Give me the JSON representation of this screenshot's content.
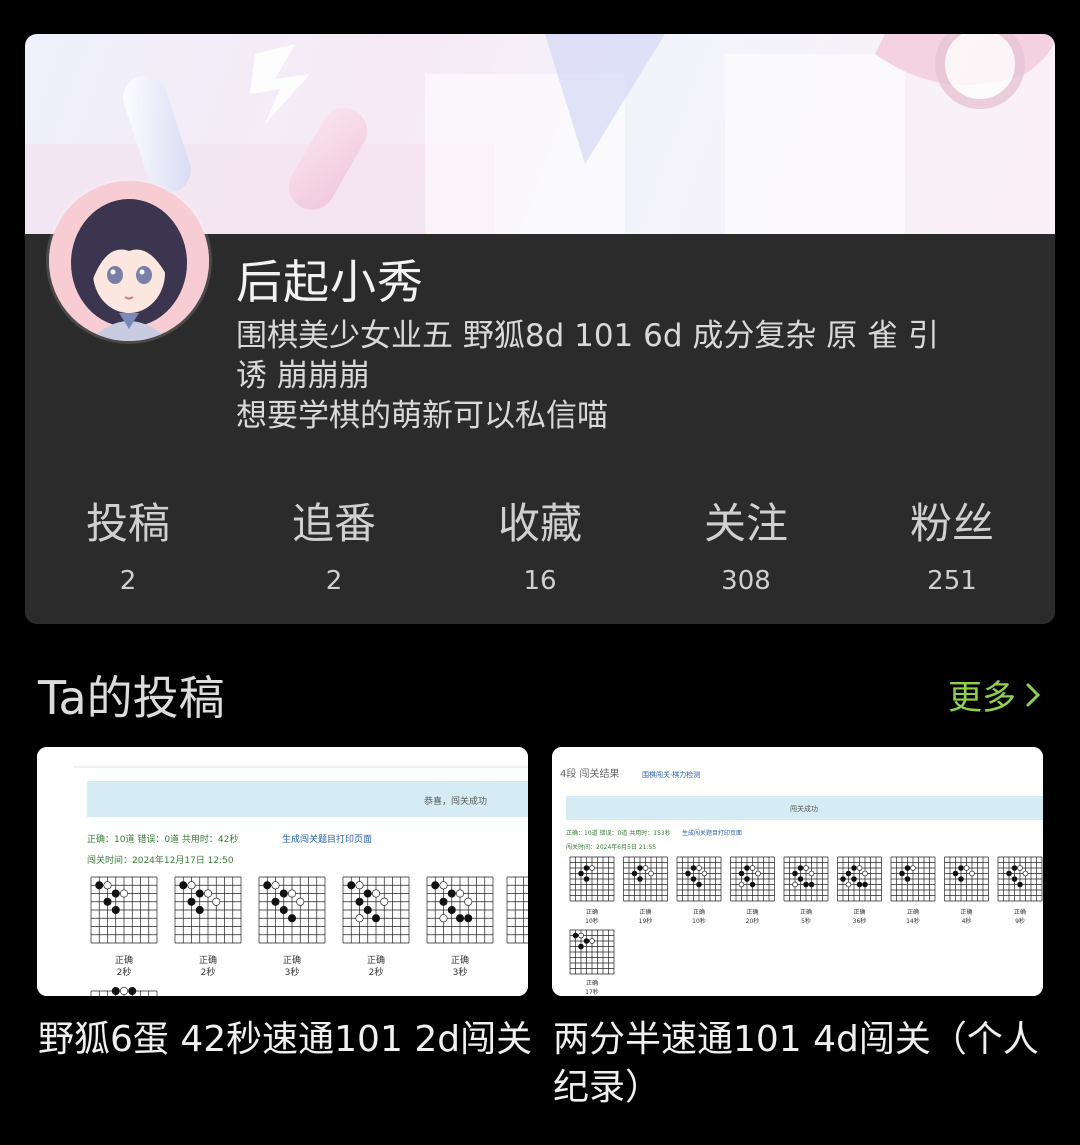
{
  "profile": {
    "username": "后起小秀",
    "bio_lines": [
      "围棋美少女业五 野狐8d 101 6d 成分复杂 原 雀 引",
      "诱 崩崩崩",
      "想要学棋的萌新可以私信喵"
    ]
  },
  "stats": [
    {
      "label": "投稿",
      "value": "2"
    },
    {
      "label": "追番",
      "value": "2"
    },
    {
      "label": "收藏",
      "value": "16"
    },
    {
      "label": "关注",
      "value": "308"
    },
    {
      "label": "粉丝",
      "value": "251"
    }
  ],
  "section": {
    "title": "Ta的投稿",
    "more_label": "更多"
  },
  "posts": [
    {
      "title": "野狐6蛋 42秒速通101 2d闯关",
      "thumb": {
        "header": "恭喜，闯关成功",
        "summary": "正确：10道  错误：0道  共用时：42秒",
        "print_link": "生成闯关题目打印页面",
        "time": "闯关时间：2024年12月17日 12:50",
        "captions": [
          [
            "正确",
            "2秒"
          ],
          [
            "正确",
            "2秒"
          ],
          [
            "正确",
            "3秒"
          ],
          [
            "正确",
            "2秒"
          ],
          [
            "正确",
            "3秒"
          ]
        ]
      }
    },
    {
      "title": "两分半速通101 4d闯关（个人纪录）",
      "thumb": {
        "top": "4段 闯关结果",
        "top_link": "围棋闯关·棋力检测",
        "header": "闯关成功",
        "summary": "正确：10道  错误：0道  共用时：153秒",
        "print_link": "生成闯关题目打印页面",
        "time": "闯关时间：2024年6月5日 21:55",
        "captions": [
          [
            "正确",
            "10秒"
          ],
          [
            "正确",
            "19秒"
          ],
          [
            "正确",
            "10秒"
          ],
          [
            "正确",
            "20秒"
          ],
          [
            "正确",
            "5秒"
          ],
          [
            "正确",
            "36秒"
          ],
          [
            "正确",
            "14秒"
          ],
          [
            "正确",
            "4秒"
          ],
          [
            "正确",
            "9秒"
          ],
          [
            "正确",
            "17秒"
          ]
        ]
      }
    }
  ],
  "colors": {
    "background": "#000000",
    "card": "#2b2b2b",
    "accent_green": "#8fd14f"
  }
}
